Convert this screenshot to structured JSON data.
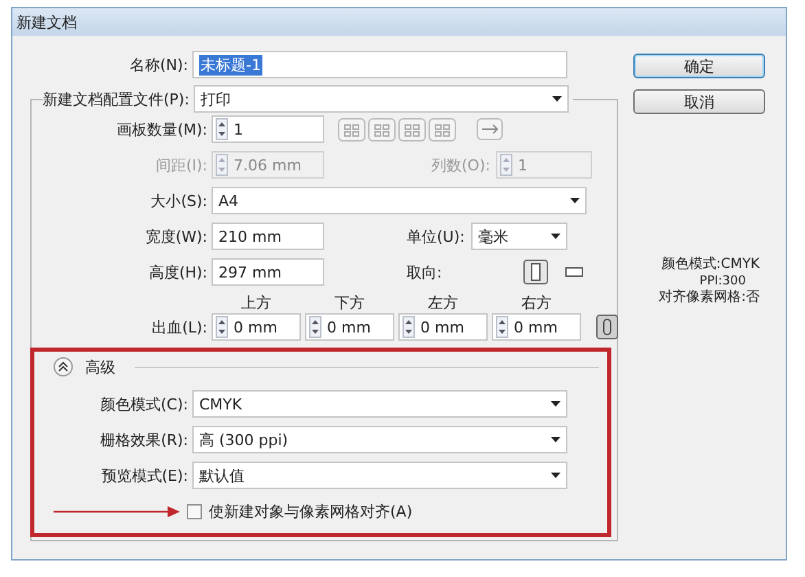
{
  "window": {
    "title": "新建文档"
  },
  "name": {
    "label": "名称(N):",
    "value": "未标题-1",
    "highlighted": true
  },
  "profile": {
    "label": "新建文档配置文件(P):",
    "value": "打印"
  },
  "artboards": {
    "label": "画板数量(M):",
    "value": "1"
  },
  "spacing": {
    "label": "间距(I):",
    "value": "7.06 mm",
    "disabled": true
  },
  "columns": {
    "label": "列数(O):",
    "value": "1",
    "disabled": true
  },
  "size": {
    "label": "大小(S):",
    "value": "A4"
  },
  "width": {
    "label": "宽度(W):",
    "value": "210 mm"
  },
  "units": {
    "label": "单位(U):",
    "value": "毫米"
  },
  "height": {
    "label": "高度(H):",
    "value": "297 mm"
  },
  "orientation": {
    "label": "取向:",
    "options": [
      {
        "kind": "portrait",
        "selected": true
      },
      {
        "kind": "landscape",
        "selected": false
      }
    ]
  },
  "bleed": {
    "label": "出血(L):",
    "linked": true,
    "sides": [
      {
        "label": "上方",
        "value": "0 mm"
      },
      {
        "label": "下方",
        "value": "0 mm"
      },
      {
        "label": "左方",
        "value": "0 mm"
      },
      {
        "label": "右方",
        "value": "0 mm"
      }
    ]
  },
  "advanced": {
    "label": "高级",
    "expanded": true,
    "fields": [
      {
        "label": "颜色模式(C):",
        "value": "CMYK"
      },
      {
        "label": "栅格效果(R):",
        "value": "高 (300 ppi)"
      },
      {
        "label": "预览模式(E):",
        "value": "默认值"
      }
    ],
    "align_checkbox": {
      "label": "使新建对象与像素网格对齐(A)",
      "checked": false
    }
  },
  "buttons": [
    {
      "label": "确定",
      "default": true
    },
    {
      "label": "取消",
      "default": false
    }
  ],
  "summary": [
    "颜色模式:CMYK",
    "PPI:300",
    "对齐像素网格:否"
  ]
}
